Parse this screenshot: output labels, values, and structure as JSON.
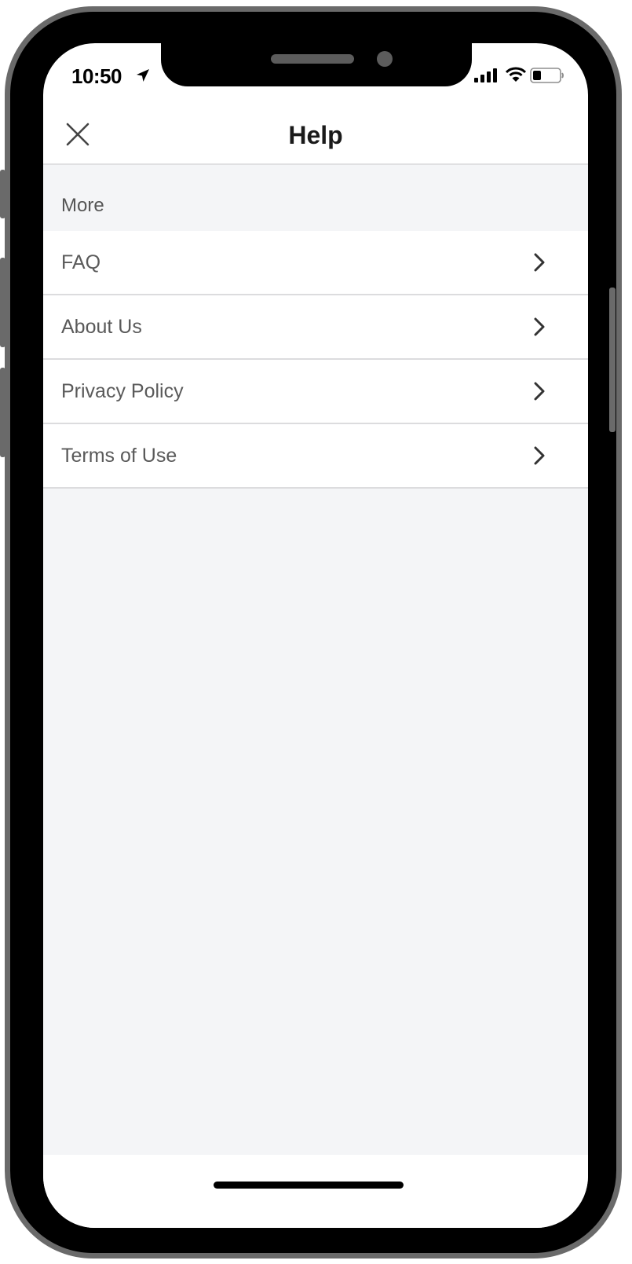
{
  "status_bar": {
    "time": "10:50",
    "icons": [
      "location-arrow-icon",
      "signal-icon",
      "wifi-icon",
      "battery-icon"
    ]
  },
  "nav": {
    "title": "Help",
    "close_icon": "close-icon"
  },
  "section": {
    "header": "More"
  },
  "menu": {
    "items": [
      {
        "label": "FAQ",
        "icon": "chevron-right-icon"
      },
      {
        "label": "About Us",
        "icon": "chevron-right-icon"
      },
      {
        "label": "Privacy Policy",
        "icon": "chevron-right-icon"
      },
      {
        "label": "Terms of Use",
        "icon": "chevron-right-icon"
      }
    ]
  },
  "colors": {
    "background": "#f4f5f7",
    "list_background": "#ffffff",
    "divider": "#dcdcde",
    "text_primary": "#1a1a1a",
    "text_secondary": "#5a5a5a"
  }
}
